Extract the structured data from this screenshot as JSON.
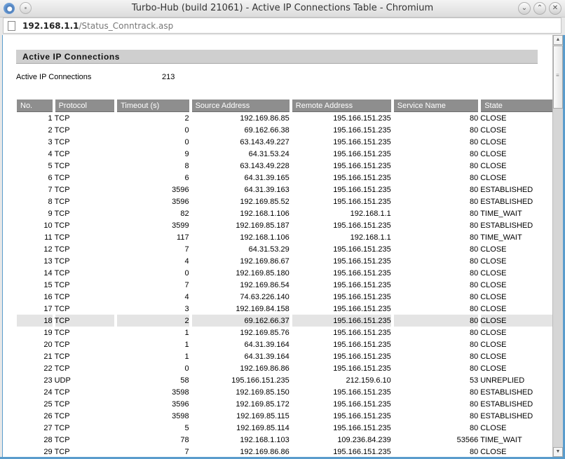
{
  "window": {
    "title": "Turbo-Hub (build 21061) - Active IP Connections Table - Chromium",
    "controls": {
      "minimize": "⌄",
      "maximize": "⌃",
      "close": "✕"
    }
  },
  "addressbar": {
    "host": "192.168.1.1",
    "path": "/Status_Conntrack.asp"
  },
  "page": {
    "section_title": "Active IP Connections",
    "summary_label": "Active IP Connections",
    "summary_value": "213"
  },
  "table": {
    "headers": [
      "No.",
      "Protocol",
      "Timeout (s)",
      "Source Address",
      "Remote Address",
      "Service Name",
      "State"
    ],
    "highlighted_row": 18,
    "rows": [
      [
        "1",
        "TCP",
        "2",
        "192.169.86.85",
        "195.166.151.235",
        "80",
        "CLOSE"
      ],
      [
        "2",
        "TCP",
        "0",
        "69.162.66.38",
        "195.166.151.235",
        "80",
        "CLOSE"
      ],
      [
        "3",
        "TCP",
        "0",
        "63.143.49.227",
        "195.166.151.235",
        "80",
        "CLOSE"
      ],
      [
        "4",
        "TCP",
        "9",
        "64.31.53.24",
        "195.166.151.235",
        "80",
        "CLOSE"
      ],
      [
        "5",
        "TCP",
        "8",
        "63.143.49.228",
        "195.166.151.235",
        "80",
        "CLOSE"
      ],
      [
        "6",
        "TCP",
        "6",
        "64.31.39.165",
        "195.166.151.235",
        "80",
        "CLOSE"
      ],
      [
        "7",
        "TCP",
        "3596",
        "64.31.39.163",
        "195.166.151.235",
        "80",
        "ESTABLISHED"
      ],
      [
        "8",
        "TCP",
        "3596",
        "192.169.85.52",
        "195.166.151.235",
        "80",
        "ESTABLISHED"
      ],
      [
        "9",
        "TCP",
        "82",
        "192.168.1.106",
        "192.168.1.1",
        "80",
        "TIME_WAIT"
      ],
      [
        "10",
        "TCP",
        "3599",
        "192.169.85.187",
        "195.166.151.235",
        "80",
        "ESTABLISHED"
      ],
      [
        "11",
        "TCP",
        "117",
        "192.168.1.106",
        "192.168.1.1",
        "80",
        "TIME_WAIT"
      ],
      [
        "12",
        "TCP",
        "7",
        "64.31.53.29",
        "195.166.151.235",
        "80",
        "CLOSE"
      ],
      [
        "13",
        "TCP",
        "4",
        "192.169.86.67",
        "195.166.151.235",
        "80",
        "CLOSE"
      ],
      [
        "14",
        "TCP",
        "0",
        "192.169.85.180",
        "195.166.151.235",
        "80",
        "CLOSE"
      ],
      [
        "15",
        "TCP",
        "7",
        "192.169.86.54",
        "195.166.151.235",
        "80",
        "CLOSE"
      ],
      [
        "16",
        "TCP",
        "4",
        "74.63.226.140",
        "195.166.151.235",
        "80",
        "CLOSE"
      ],
      [
        "17",
        "TCP",
        "3",
        "192.169.84.158",
        "195.166.151.235",
        "80",
        "CLOSE"
      ],
      [
        "18",
        "TCP",
        "2",
        "69.162.66.37",
        "195.166.151.235",
        "80",
        "CLOSE"
      ],
      [
        "19",
        "TCP",
        "1",
        "192.169.85.76",
        "195.166.151.235",
        "80",
        "CLOSE"
      ],
      [
        "20",
        "TCP",
        "1",
        "64.31.39.164",
        "195.166.151.235",
        "80",
        "CLOSE"
      ],
      [
        "21",
        "TCP",
        "1",
        "64.31.39.164",
        "195.166.151.235",
        "80",
        "CLOSE"
      ],
      [
        "22",
        "TCP",
        "0",
        "192.169.86.86",
        "195.166.151.235",
        "80",
        "CLOSE"
      ],
      [
        "23",
        "UDP",
        "58",
        "195.166.151.235",
        "212.159.6.10",
        "53",
        "UNREPLIED"
      ],
      [
        "24",
        "TCP",
        "3598",
        "192.169.85.150",
        "195.166.151.235",
        "80",
        "ESTABLISHED"
      ],
      [
        "25",
        "TCP",
        "3596",
        "192.169.85.172",
        "195.166.151.235",
        "80",
        "ESTABLISHED"
      ],
      [
        "26",
        "TCP",
        "3598",
        "192.169.85.115",
        "195.166.151.235",
        "80",
        "ESTABLISHED"
      ],
      [
        "27",
        "TCP",
        "5",
        "192.169.85.114",
        "195.166.151.235",
        "80",
        "CLOSE"
      ],
      [
        "28",
        "TCP",
        "78",
        "192.168.1.103",
        "109.236.84.239",
        "53566",
        "TIME_WAIT"
      ],
      [
        "29",
        "TCP",
        "7",
        "192.169.86.86",
        "195.166.151.235",
        "80",
        "CLOSE"
      ]
    ]
  }
}
